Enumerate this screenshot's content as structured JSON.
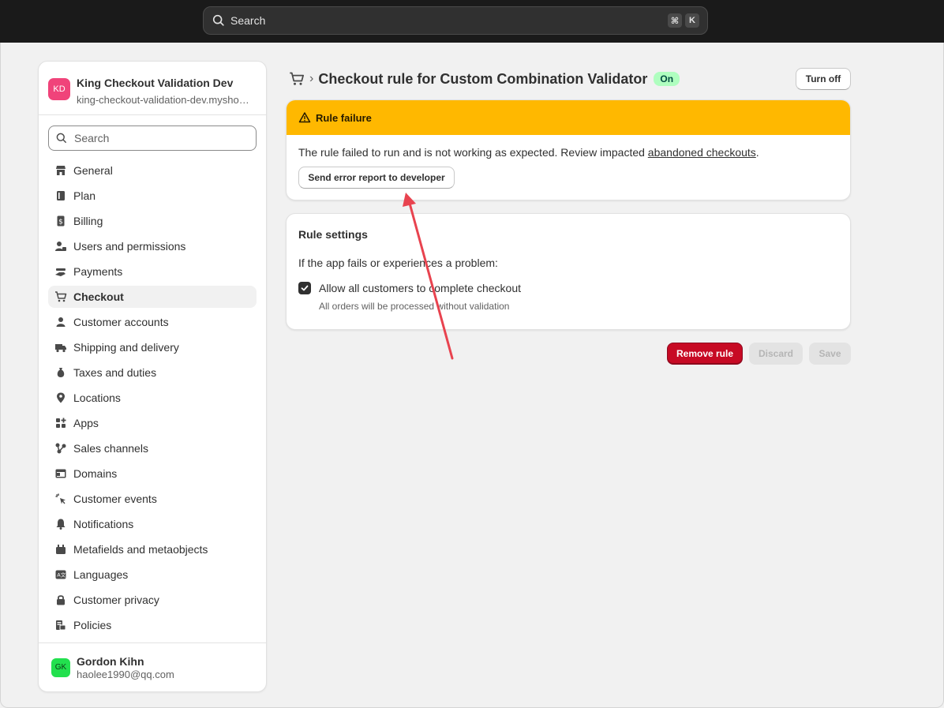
{
  "topbar": {
    "search_placeholder": "Search",
    "shortcut_keys": [
      "⌘",
      "K"
    ]
  },
  "sidebar": {
    "store": {
      "initials": "KD",
      "name": "King Checkout Validation Dev",
      "domain": "king-checkout-validation-dev.myshopify.com",
      "avatar_color": "#f0437a"
    },
    "search_placeholder": "Search",
    "items": [
      {
        "label": "General",
        "icon": "store-icon"
      },
      {
        "label": "Plan",
        "icon": "plan-icon"
      },
      {
        "label": "Billing",
        "icon": "billing-icon"
      },
      {
        "label": "Users and permissions",
        "icon": "users-icon"
      },
      {
        "label": "Payments",
        "icon": "payments-icon"
      },
      {
        "label": "Checkout",
        "icon": "cart-icon",
        "active": true
      },
      {
        "label": "Customer accounts",
        "icon": "person-icon"
      },
      {
        "label": "Shipping and delivery",
        "icon": "truck-icon"
      },
      {
        "label": "Taxes and duties",
        "icon": "tax-icon"
      },
      {
        "label": "Locations",
        "icon": "location-icon"
      },
      {
        "label": "Apps",
        "icon": "apps-icon"
      },
      {
        "label": "Sales channels",
        "icon": "channels-icon"
      },
      {
        "label": "Domains",
        "icon": "domains-icon"
      },
      {
        "label": "Customer events",
        "icon": "cursor-icon"
      },
      {
        "label": "Notifications",
        "icon": "bell-icon"
      },
      {
        "label": "Metafields and metaobjects",
        "icon": "metafields-icon"
      },
      {
        "label": "Languages",
        "icon": "language-icon"
      },
      {
        "label": "Customer privacy",
        "icon": "lock-icon"
      },
      {
        "label": "Policies",
        "icon": "policies-icon"
      }
    ],
    "user": {
      "initials": "GK",
      "name": "Gordon Kihn",
      "email": "haolee1990@qq.com",
      "avatar_color": "#22e04e"
    }
  },
  "page": {
    "title": "Checkout rule for Custom Combination Validator",
    "status_badge": "On",
    "turn_off_label": "Turn off"
  },
  "failure": {
    "title": "Rule failure",
    "message_prefix": "The rule failed to run and is not working as expected. Review impacted ",
    "link_text": "abandoned checkouts",
    "message_suffix": ".",
    "button_label": "Send error report to developer",
    "banner_color": "#ffb800"
  },
  "settings": {
    "title": "Rule settings",
    "question": "If the app fails or experiences a problem:",
    "checkbox_label": "Allow all customers to complete checkout",
    "checkbox_checked": true,
    "checkbox_help": "All orders will be processed without validation"
  },
  "actions": {
    "remove_label": "Remove rule",
    "discard_label": "Discard",
    "save_label": "Save",
    "remove_color": "#c70a24"
  },
  "annotation": {
    "arrow_color": "#e8434f"
  }
}
